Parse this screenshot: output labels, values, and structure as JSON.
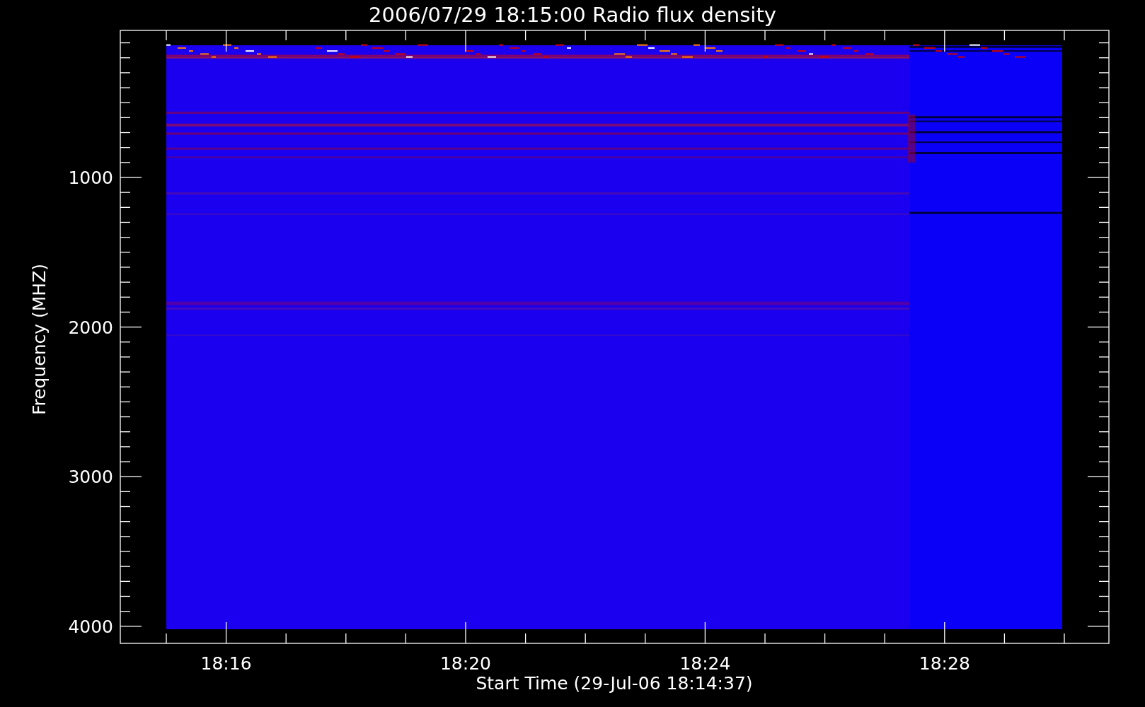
{
  "chart": {
    "title": "2006/07/29 18:15:00 Radio flux density",
    "xlabel": "Start Time (29-Jul-06 18:14:37)",
    "ylabel": "Frequency (MHZ)",
    "xticks": [
      "18:16",
      "18:20",
      "18:24",
      "18:28"
    ],
    "yticks": [
      "1000",
      "2000",
      "3000",
      "4000"
    ]
  }
}
